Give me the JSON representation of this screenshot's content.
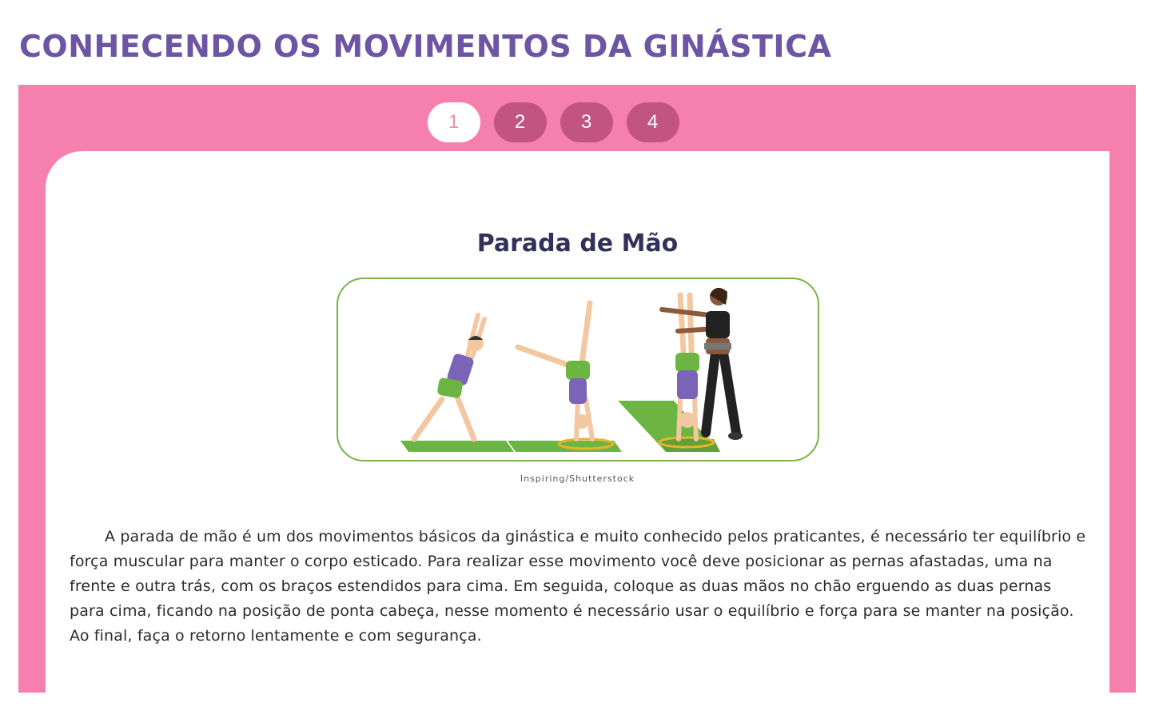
{
  "page": {
    "title": "CONHECENDO OS MOVIMENTOS DA GINÁSTICA"
  },
  "tabs": [
    {
      "label": "1",
      "active": true
    },
    {
      "label": "2",
      "active": false
    },
    {
      "label": "3",
      "active": false
    },
    {
      "label": "4",
      "active": false
    }
  ],
  "slide": {
    "title": "Parada de Mão",
    "image_credit": "Inspiring/Shutterstock",
    "body": "A parada de mão é um dos movimentos básicos da ginástica e muito conhecido pelos praticantes, é necessário ter equilíbrio e força muscular para manter o corpo esticado. Para realizar esse movimento você deve posicionar as pernas afastadas, uma na frente e outra trás, com os braços estendidos para cima. Em seguida, coloque as duas mãos no chão erguendo as duas pernas para cima, ficando na posição de ponta cabeça, nesse momento é necessário usar o equilíbrio e força para se manter na posição. Ao final, faça o retorno lentamente e com segurança."
  },
  "colors": {
    "title_purple": "#6d55a3",
    "panel_pink": "#f580ad",
    "tab_dark_pink": "#c2557f",
    "figure_border_green": "#7bb24a",
    "mat_green": "#6db543"
  },
  "icons": {
    "illustration": "handstand-illustration"
  }
}
